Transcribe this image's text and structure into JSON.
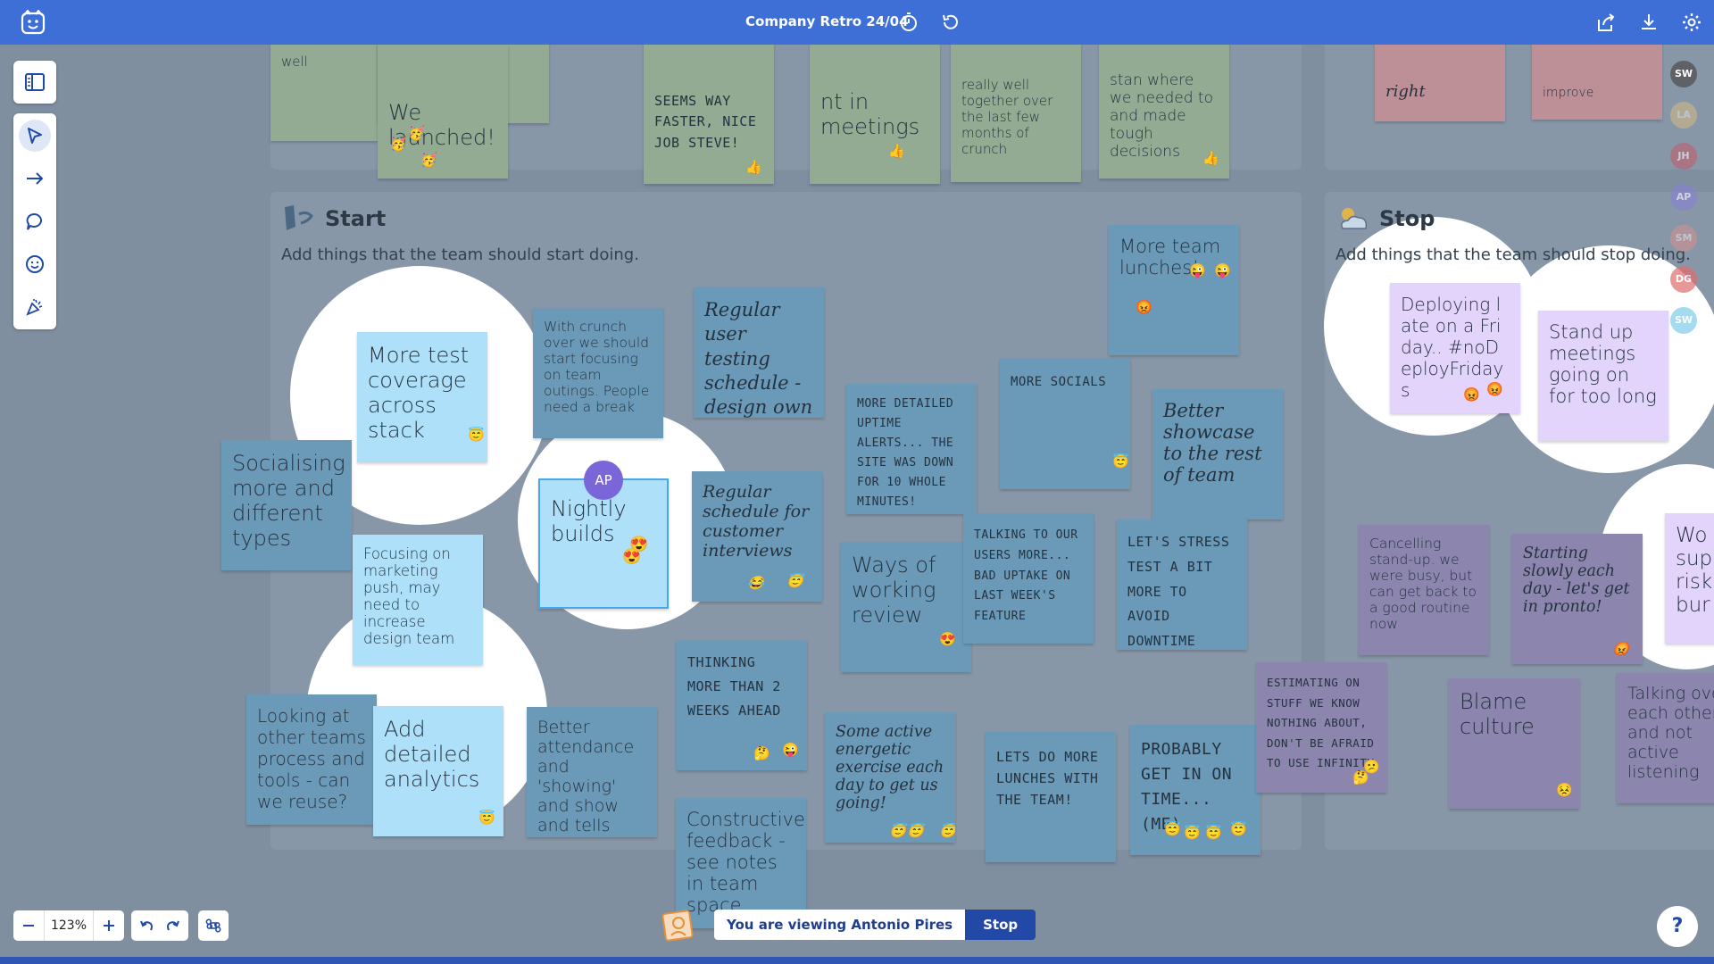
{
  "app": {
    "title": "Company Retro 24/04"
  },
  "sections": {
    "start": {
      "title": "Start",
      "subtitle": "Add things that the team should start doing."
    },
    "stop": {
      "title": "Stop",
      "subtitle": "Add things that the team should stop doing."
    }
  },
  "top_notes": [
    "well",
    "We launched!",
    "SEEMS WAY FASTER, NICE JOB STEVE!",
    "nt in meetings",
    "really well together over the last few months of crunch",
    "stan where we needed to and made tough decisions",
    "right",
    "improve"
  ],
  "start_notes": [
    "More test coverage across stack",
    "With crunch over we should start focusing on team outings. People need a break",
    "Regular user testing schedule - design own",
    "More team lunches!",
    "Socialising more and different types",
    "Focusing on marketing push, may need to increase design team",
    "Nightly builds",
    "Regular schedule for customer interviews",
    "MORE DETAILED UPTIME ALERTS... THE SITE WAS DOWN FOR 10 WHOLE MINUTES!",
    "MORE SOCIALS",
    "Better showcase to the rest of team",
    "Ways of working review",
    "TALKING TO OUR USERS MORE... BAD UPTAKE ON LAST WEEK'S FEATURE",
    "LET'S STRESS TEST A BIT MORE TO AVOID DOWNTIME",
    "THINKING MORE THAN 2 WEEKS AHEAD",
    "Looking at other teams process and tools - can we reuse?",
    "Add detailed analytics",
    "Better attendance and 'showing' and show and tells",
    "Some active energetic exercise each day to get us going!",
    "LETS DO MORE LUNCHES WITH THE TEAM!",
    "PROBABLY GET IN ON TIME... (ME)",
    "Constructive feedback - see notes in team space"
  ],
  "stop_notes": [
    "Deploying late on a Friday.. #noDeployFridays",
    "Stand up meetings going on for too long",
    "Cancelling stand-up. we were busy, but can get back to a good routine now",
    "Starting slowly each day - let's get in pronto!",
    "Wo sup risk bur",
    "ESTIMATING ON STUFF WE KNOW NOTHING ABOUT, DON'T BE AFRAID TO USE INFINITY",
    "Blame culture",
    "Talking ove each other and not active listening"
  ],
  "cursor_label": "AP",
  "avatars": [
    "SW",
    "LA",
    "JH",
    "AP",
    "SM",
    "DG",
    "SW"
  ],
  "avatar_colors": [
    "#5f6166",
    "#e6c27a",
    "#c65a6a",
    "#8a7fd6",
    "#e99089",
    "#e06d6d",
    "#7fcdea"
  ],
  "zoom": "123%",
  "viewing": {
    "message": "You are viewing Antonio Pires",
    "stop_label": "Stop"
  },
  "help_label": "?",
  "colors": {
    "topbar": "#3d6fd6",
    "accent": "#2248a8"
  }
}
